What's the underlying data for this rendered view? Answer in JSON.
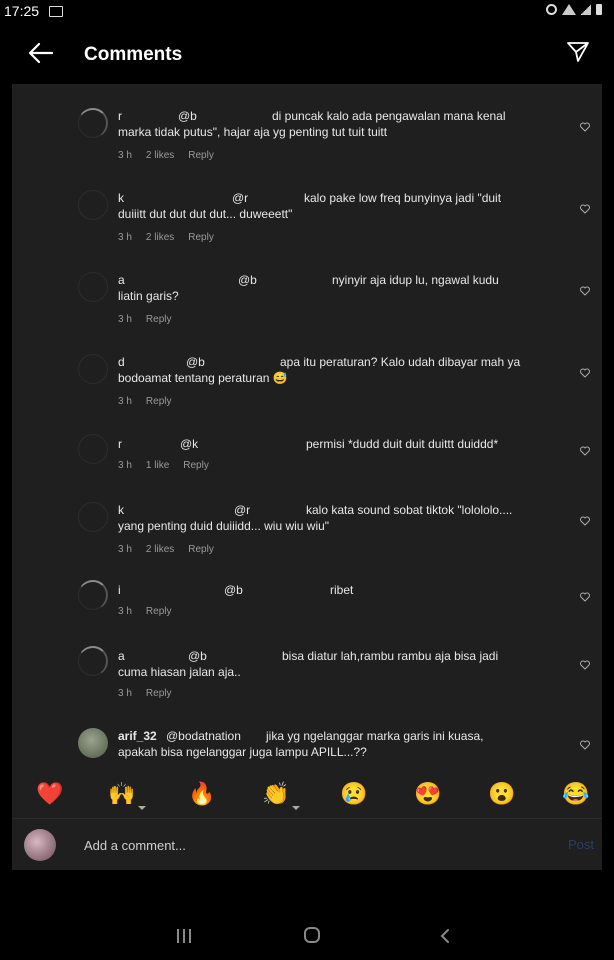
{
  "status": {
    "time": "17:25"
  },
  "header": {
    "title": "Comments"
  },
  "comments": [
    {
      "user": "r",
      "mention": "@b",
      "text1": "di puncak kalo ada pengawalan mana kenal",
      "text2": "marka tidak putus\", hajar aja yg penting tut tuit tuitt",
      "time": "3 h",
      "likes": "2 likes",
      "reply": "Reply"
    },
    {
      "user": "k",
      "mention": "@r",
      "text1": "kalo pake low freq bunyinya jadi \"duit",
      "text2": "duiiitt dut dut dut dut... duweeett\"",
      "time": "3 h",
      "likes": "2 likes",
      "reply": "Reply"
    },
    {
      "user": "a",
      "mention": "@b",
      "text1": "nyinyir aja idup lu, ngawal kudu",
      "text2": "liatin garis?",
      "time": "3 h",
      "likes": "",
      "reply": "Reply"
    },
    {
      "user": "d",
      "mention": "@b",
      "text1": "apa itu peraturan? Kalo udah dibayar mah ya",
      "text2": "bodoamat tentang peraturan 😅",
      "time": "3 h",
      "likes": "",
      "reply": "Reply"
    },
    {
      "user": "r",
      "mention": "@k",
      "text1": "permisi *dudd duit duit duittt duiddd*",
      "text2": "",
      "time": "3 h",
      "likes": "1 like",
      "reply": "Reply"
    },
    {
      "user": "k",
      "mention": "@r",
      "text1": "kalo kata sound sobat tiktok \"lolololo....",
      "text2": "yang penting duid duiiidd... wiu wiu wiu\"",
      "time": "3 h",
      "likes": "2 likes",
      "reply": "Reply"
    },
    {
      "user": "i",
      "mention": "@b",
      "text1": "ribet",
      "text2": "",
      "time": "3 h",
      "likes": "",
      "reply": "Reply"
    },
    {
      "user": "a",
      "mention": "@b",
      "text1": "bisa diatur lah,rambu rambu aja bisa jadi",
      "text2": "cuma hiasan jalan aja..",
      "time": "3 h",
      "likes": "",
      "reply": "Reply"
    },
    {
      "user": "arif_32",
      "mention": "@bodatnation",
      "text1": "jika yg ngelanggar marka garis ini kuasa,",
      "text2": "apakah bisa ngelanggar juga lampu APILL...??",
      "time": "",
      "likes": "",
      "reply": ""
    }
  ],
  "emoji_bar": [
    "❤️",
    "🙌",
    "🔥",
    "👏",
    "😢",
    "😍",
    "😮",
    "😂"
  ],
  "compose": {
    "placeholder": "Add a comment...",
    "post_label": "Post"
  }
}
